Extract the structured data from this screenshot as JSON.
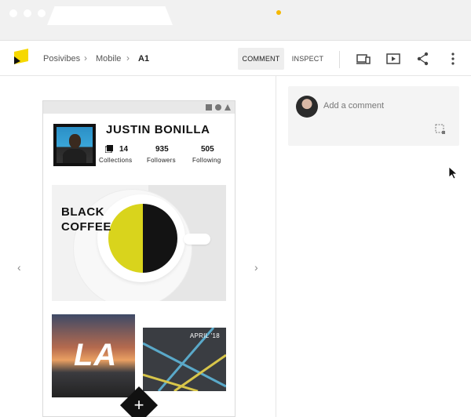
{
  "breadcrumbs": {
    "project": "Posivibes",
    "folder": "Mobile",
    "screen": "A1"
  },
  "toolbar": {
    "comment_label": "COMMENT",
    "inspect_label": "INSPECT",
    "notification_color": "#f6b800"
  },
  "profile": {
    "name": "JUSTIN BONILLA",
    "stats": [
      {
        "value": "14",
        "label": "Collections"
      },
      {
        "value": "935",
        "label": "Followers"
      },
      {
        "value": "505",
        "label": "Following"
      }
    ]
  },
  "feed": {
    "coffee_title_line1": "BLACK",
    "coffee_title_line2": "COFFEE",
    "photo_la_text": "LA",
    "photo_april_text": "APRIL '18"
  },
  "comments": {
    "input_placeholder": "Add a comment"
  },
  "colors": {
    "accent_yellow": "#f6d800",
    "text_dark": "#111111"
  }
}
